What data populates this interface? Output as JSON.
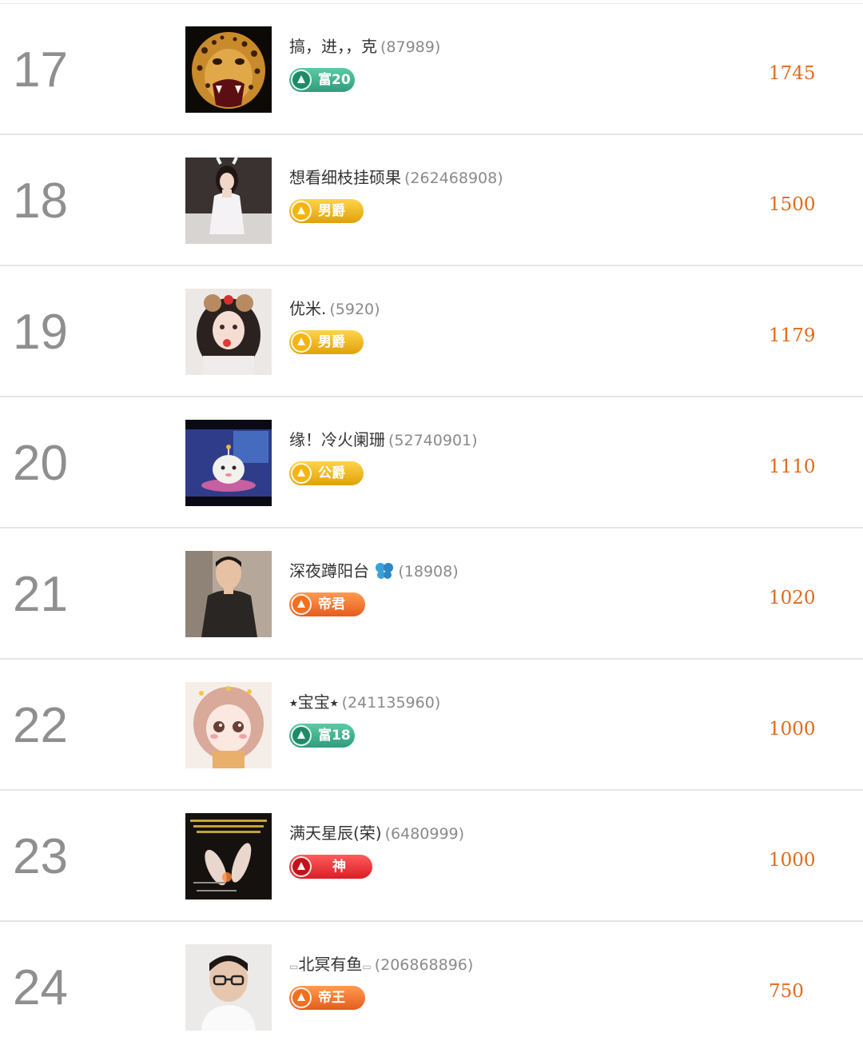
{
  "rows": [
    {
      "rank": "17",
      "nickname": "搞，进，，克",
      "uid": "(87989)",
      "badge": "富20",
      "badge_type": "rich",
      "score": "1745",
      "avatar_icon": "leopard-avatar"
    },
    {
      "rank": "18",
      "nickname": "想看细枝挂硕果",
      "uid": "(262468908)",
      "badge": "男爵",
      "badge_type": "gold",
      "score": "1500",
      "avatar_icon": "woman-avatar"
    },
    {
      "rank": "19",
      "nickname": "优米.",
      "uid": "(5920)",
      "badge": "男爵",
      "badge_type": "gold",
      "score": "1179",
      "avatar_icon": "girl-avatar"
    },
    {
      "rank": "20",
      "nickname": "缘！冷火阑珊",
      "uid": "(52740901)",
      "badge": "公爵",
      "badge_type": "gold",
      "score": "1110",
      "avatar_icon": "cartoon-avatar"
    },
    {
      "rank": "21",
      "nickname": "深夜蹲阳台",
      "uid": "(18908)",
      "badge": "帝君",
      "badge_type": "orange",
      "score": "1020",
      "avatar_icon": "man-avatar"
    },
    {
      "rank": "22",
      "nickname": "⭑宝宝⭑",
      "uid": "(241135960)",
      "badge": "富18",
      "badge_type": "rich",
      "score": "1000",
      "avatar_icon": "anime-girl-avatar"
    },
    {
      "rank": "23",
      "nickname": "满天星辰(荣)",
      "uid": "(6480999)",
      "badge": "神",
      "badge_type": "red",
      "score": "1000",
      "avatar_icon": "hands-avatar"
    },
    {
      "rank": "24",
      "nickname": "北冥有鱼",
      "uid": "(206868896)",
      "badge": "帝王",
      "badge_type": "orange",
      "score": "750",
      "avatar_icon": "glasses-man-avatar"
    }
  ],
  "colors": {
    "rank": "#8f8f8f",
    "score": "#e06a1c",
    "rich": "#3aaa85",
    "gold": "#f0b41a",
    "orange": "#f07020",
    "red": "#d91e25"
  }
}
